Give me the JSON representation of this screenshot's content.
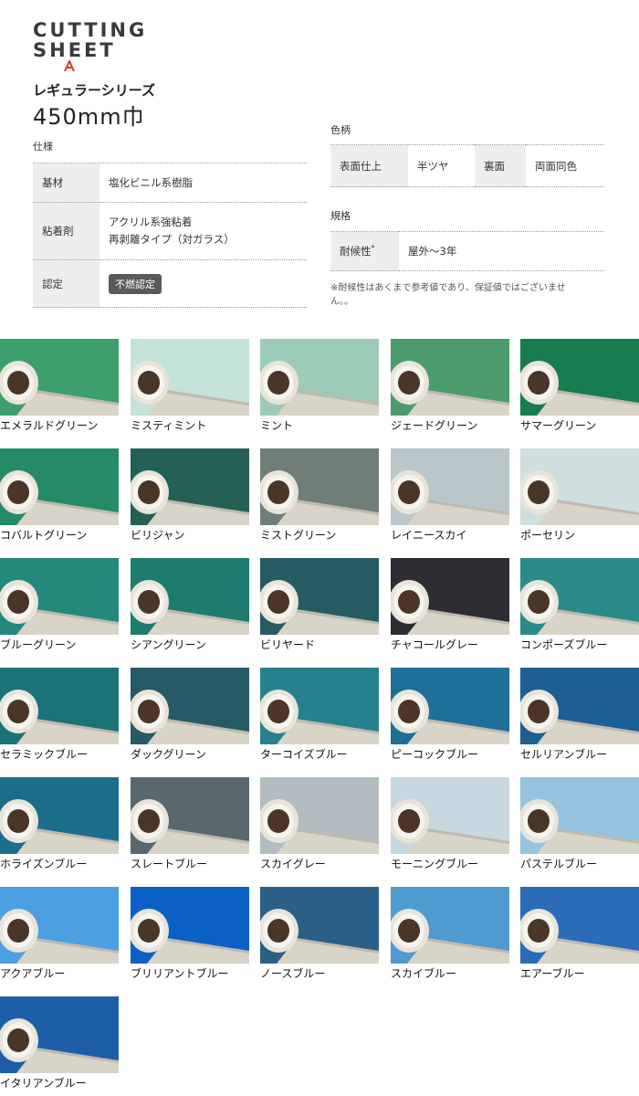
{
  "brand": {
    "line1": "CUTTING",
    "line2": "SHEET",
    "series": "レギュラーシリーズ",
    "size": "450mm巾",
    "accent_color": "#d63a2e"
  },
  "spec": {
    "heading": "仕様",
    "rows": [
      {
        "label": "基材",
        "value": "塩化ビニル系樹脂"
      },
      {
        "label": "粘着剤",
        "value_line1": "アクリル系強粘着",
        "value_line2": "再剥離タイプ（対ガラス）"
      },
      {
        "label": "認定",
        "badge": "不燃認定"
      }
    ]
  },
  "color_pattern": {
    "heading": "色柄",
    "surface_label": "表面仕上",
    "surface_value": "半ツヤ",
    "back_label": "裏面",
    "back_value": "両面同色"
  },
  "standard": {
    "heading": "規格",
    "weather_label": "耐候性",
    "weather_mark": "*",
    "weather_value": "屋外～3年",
    "note": "※耐候性はあくまで参考値であり、保証値ではございません。。"
  },
  "swatches": [
    {
      "name": "エメラルドグリーン",
      "color": "#3c9f6c"
    },
    {
      "name": "ミスティミント",
      "color": "#c4e3da"
    },
    {
      "name": "ミント",
      "color": "#9ccbb8"
    },
    {
      "name": "ジェードグリーン",
      "color": "#4c9b6c"
    },
    {
      "name": "サマーグリーン",
      "color": "#177c4e"
    },
    {
      "name": "コバルトグリーン",
      "color": "#268a66"
    },
    {
      "name": "ビリジャン",
      "color": "#235f55"
    },
    {
      "name": "ミストグリーン",
      "color": "#6f7f77"
    },
    {
      "name": "レイニースカイ",
      "color": "#b9c7ca"
    },
    {
      "name": "ポーセリン",
      "color": "#cfdfe0"
    },
    {
      "name": "ブルーグリーン",
      "color": "#24887d"
    },
    {
      "name": "シアングリーン",
      "color": "#1d7b6f"
    },
    {
      "name": "ビリヤード",
      "color": "#265b64"
    },
    {
      "name": "チャコールグレー",
      "color": "#2d2d33"
    },
    {
      "name": "コンポーズブルー",
      "color": "#2b8b8a"
    },
    {
      "name": "セラミックブルー",
      "color": "#1b7278"
    },
    {
      "name": "ダックグリーン",
      "color": "#265a67"
    },
    {
      "name": "ターコイズブルー",
      "color": "#26818f"
    },
    {
      "name": "ピーコックブルー",
      "color": "#1f6f9b"
    },
    {
      "name": "セルリアンブルー",
      "color": "#1b5f94"
    },
    {
      "name": "ホライズンブルー",
      "color": "#1c6c8c"
    },
    {
      "name": "スレートブルー",
      "color": "#59686f"
    },
    {
      "name": "スカイグレー",
      "color": "#b3bcc1"
    },
    {
      "name": "モーニングブルー",
      "color": "#c8d8e0"
    },
    {
      "name": "パステルブルー",
      "color": "#94c4e0"
    },
    {
      "name": "アクアブルー",
      "color": "#4c9fe0"
    },
    {
      "name": "ブリリアントブルー",
      "color": "#0b60c6"
    },
    {
      "name": "ノースブルー",
      "color": "#2a5f88"
    },
    {
      "name": "スカイブルー",
      "color": "#4f9bd0"
    },
    {
      "name": "エアーブルー",
      "color": "#2a6cb8"
    },
    {
      "name": "イタリアンブルー",
      "color": "#1d5ea8"
    }
  ]
}
